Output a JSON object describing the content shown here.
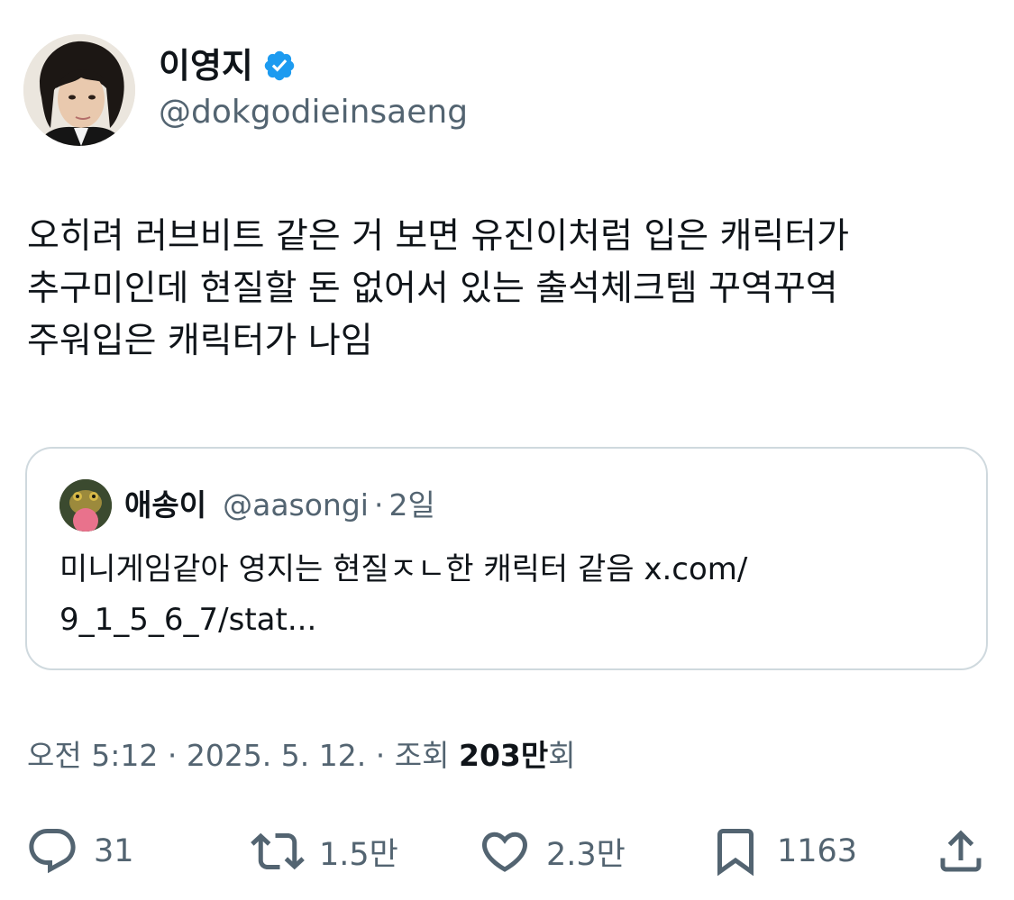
{
  "author": {
    "display_name": "이영지",
    "handle": "@dokgodieinsaeng",
    "verified": true,
    "verified_color": "#1d9bf0"
  },
  "tweet": {
    "text": "오히려 러브비트 같은 거 보면 유진이처럼 입은 캐릭터가\n추구미인데 현질할 돈 없어서 있는 출석체크템 꾸역꾸역\n주워입은 캐릭터가 나임"
  },
  "quote": {
    "display_name": "애송이",
    "handle": "@aasongi",
    "separator": "·",
    "time": "2일",
    "text": "미니게임같아 영지는 현질ㅈㄴ한 캐릭터 같음 x.com/\n9_1_5_6_7/stat..."
  },
  "meta": {
    "time": "오전 5:12",
    "separator": "·",
    "date": "2025. 5. 12.",
    "views_label": "조회",
    "views_count": "203만",
    "views_suffix": "회"
  },
  "actions": {
    "reply_count": "31",
    "retweet_count": "1.5만",
    "like_count": "2.3만",
    "bookmark_count": "1163",
    "icon_names": [
      "reply-icon",
      "retweet-icon",
      "like-icon",
      "bookmark-icon",
      "share-icon"
    ]
  },
  "colors": {
    "text_primary": "#0f1419",
    "text_secondary": "#536471",
    "border": "#cfd9de",
    "accent": "#1d9bf0"
  }
}
